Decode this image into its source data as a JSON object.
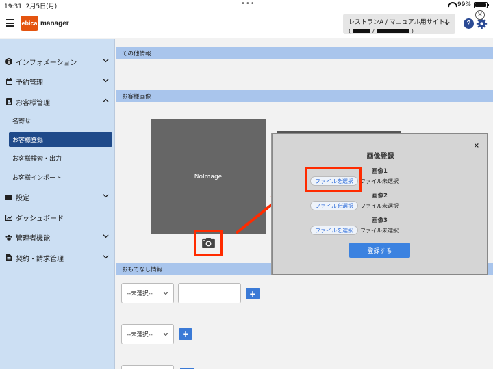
{
  "status_bar": {
    "time": "19:31",
    "date": "2月5日(月)",
    "more": "•••",
    "battery": "99%",
    "battery_level": 0.99
  },
  "header": {
    "logo_badge": "ebica",
    "logo_name": "manager",
    "site_name": "レストランA / マニュアル用サイト1",
    "help_label": "?"
  },
  "sidebar": {
    "items": [
      {
        "label": "インフォメーション",
        "icon": "info-icon"
      },
      {
        "label": "予約管理",
        "icon": "calendar-icon"
      },
      {
        "label": "お客様管理",
        "icon": "contact-card-icon"
      },
      {
        "label": "設定",
        "icon": "folder-icon"
      },
      {
        "label": "ダッシュボード",
        "icon": "chart-icon"
      },
      {
        "label": "管理者機能",
        "icon": "users-icon"
      },
      {
        "label": "契約・請求管理",
        "icon": "document-icon"
      }
    ],
    "sub_items": [
      {
        "label": "名寄せ"
      },
      {
        "label": "お客様登録"
      },
      {
        "label": "お客様検索・出力"
      },
      {
        "label": "お客様インポート"
      }
    ]
  },
  "main": {
    "sections": {
      "other_info": "その他情報",
      "customer_image": "お客様画像",
      "hospitality": "おもてなし情報"
    },
    "no_image": "NoImage",
    "selects": [
      "--未選択--",
      "--未選択--"
    ],
    "plus_label": "+"
  },
  "modal": {
    "title": "画像登録",
    "close_label": "×",
    "slots": [
      {
        "label": "画像1",
        "button": "ファイルを選択",
        "status": "ファイル未選択"
      },
      {
        "label": "画像2",
        "button": "ファイルを選択",
        "status": "ファイル未選択"
      },
      {
        "label": "画像3",
        "button": "ファイルを選択",
        "status": "ファイル未選択"
      }
    ],
    "submit": "登録する"
  },
  "colors": {
    "logo_orange": "#e4540f",
    "sidebar_bg": "#ccdff3",
    "active_nav": "#1f4a8a",
    "section_bar": "#a9c5ec",
    "primary_button": "#3b82e0",
    "highlight_red": "#ff2b00"
  }
}
